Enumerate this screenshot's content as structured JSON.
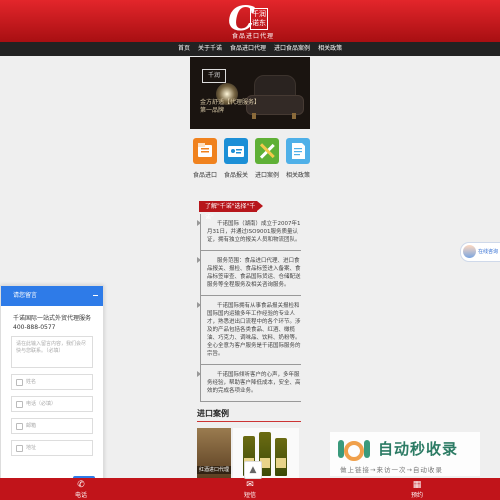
{
  "header": {
    "logo_box_text": "千润诺东",
    "logo_subtitle": "食品进口代理"
  },
  "nav": {
    "items": [
      "首页",
      "关于千诺",
      "食品进口代理",
      "进口食品案例",
      "相关政策"
    ]
  },
  "banner": {
    "tag": "千润",
    "line1": "金方舒适【代理服务】",
    "line2": "第一品牌"
  },
  "services": [
    {
      "label": "食品进口",
      "icon": "folder-icon",
      "color": "#f0821e"
    },
    {
      "label": "食品报关",
      "icon": "id-card-icon",
      "color": "#1c8fd6"
    },
    {
      "label": "进口案例",
      "icon": "tools-icon",
      "color": "#5fb036"
    },
    {
      "label": "相关政策",
      "icon": "document-icon",
      "color": "#4fb0e8"
    }
  ],
  "intro": {
    "ribbon": "了解\"千诺\"选择\"千诺\"",
    "paragraphs": [
      "千诺国际（湖南）成立于2007年1月31日，并通过ISO9001服务质量认证，拥有独立的报关人员和物流团队。",
      "服务范围：食品进口代理、进口食品报关、报检、食品标签进入备案、食品标签审查、食品国际货运、仓储配送服务等全程服务及相关咨询服务。",
      "千诺国际拥有从事食品报关报检和国际国内运输多年工作经验的专业人才，熟悉进出口流程中的各个环节。涉及的产品包括各类食品、红酒、橄榄油、巧克力、调味品、饮料、奶粉等。全心全意为客户服务是千诺国际服务的宗旨。",
      "千诺国际倾听客户的心声，多年服务经验，帮助客户降低成本，安全、高效的完成各项业务。"
    ]
  },
  "cases": {
    "title": "进口案例",
    "caption": "红酒进口代理"
  },
  "form": {
    "title": "请您留言",
    "text": "千诺国际一站式外贸代理服务400-888-0577",
    "message_placeholder": "请在此输入留言内容，我们会尽快与您联系。（必填）",
    "fields": [
      "姓名",
      "电话（必填）",
      "邮箱",
      "地址"
    ],
    "submit": "提交"
  },
  "online": {
    "label": "在线咨询"
  },
  "footer": {
    "items": [
      {
        "label": "电话",
        "icon": "phone-icon"
      },
      {
        "label": "短信",
        "icon": "message-icon"
      },
      {
        "label": "预约",
        "icon": "calendar-icon"
      }
    ]
  },
  "watermark": {
    "title": "自动秒收录",
    "subtitle": "做上链接→来访一次→自动收录"
  },
  "colors": {
    "primary": "#c1141a",
    "nav": "#222222",
    "form_accent": "#2e7be8"
  }
}
